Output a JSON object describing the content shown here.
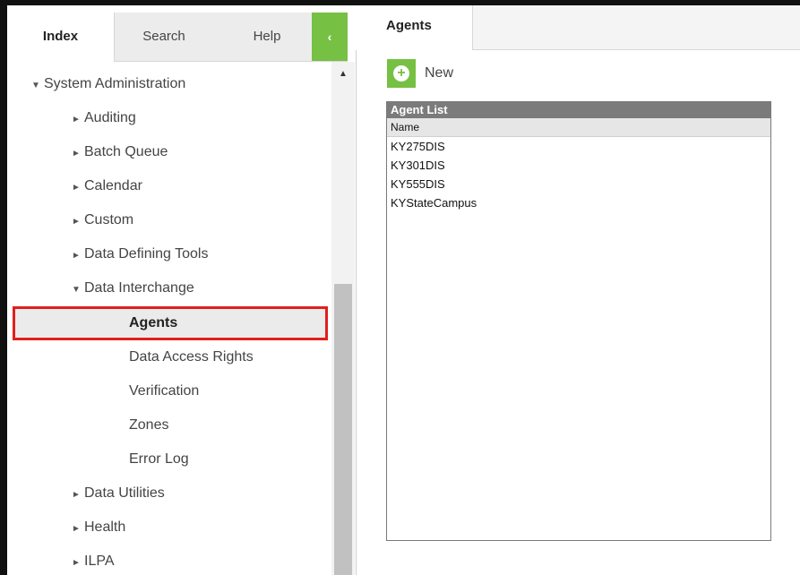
{
  "sidebar": {
    "tabs": [
      {
        "label": "Index"
      },
      {
        "label": "Search"
      },
      {
        "label": "Help"
      }
    ],
    "collapse_symbol": "‹",
    "tree": {
      "system_admin": "System Administration",
      "auditing": "Auditing",
      "batch_queue": "Batch Queue",
      "calendar": "Calendar",
      "custom": "Custom",
      "data_defining_tools": "Data Defining Tools",
      "data_interchange": "Data Interchange",
      "agents": "Agents",
      "data_access_rights": "Data Access Rights",
      "verification": "Verification",
      "zones": "Zones",
      "error_log": "Error Log",
      "data_utilities": "Data Utilities",
      "health": "Health",
      "ilpa": "ILPA"
    }
  },
  "main": {
    "tab_label": "Agents",
    "new_label": "New",
    "list": {
      "title": "Agent List",
      "column": "Name",
      "rows": [
        "KY275DIS",
        "KY301DIS",
        "KY555DIS",
        "KYStateCampus"
      ]
    }
  },
  "colors": {
    "accent_green": "#76c043",
    "highlight_red": "#e0201c",
    "list_header_gray": "#7b7b7b"
  }
}
